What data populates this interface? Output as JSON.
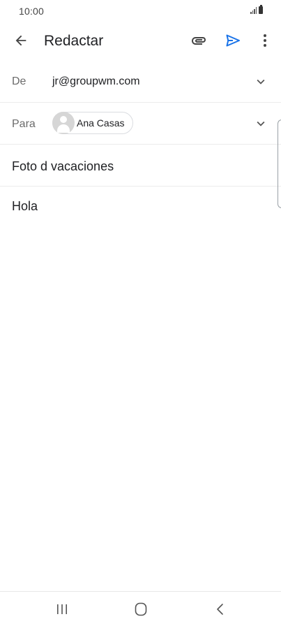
{
  "status_bar": {
    "time": "10:00"
  },
  "app_bar": {
    "title": "Redactar",
    "icons": {
      "back": "arrow-back-icon",
      "attach": "paperclip-icon",
      "send": "send-icon",
      "more": "more-vert-icon"
    },
    "send_color": "#1a73e8"
  },
  "compose": {
    "from": {
      "label": "De",
      "value": "jr@groupwm.com"
    },
    "to": {
      "label": "Para",
      "recipient": "Ana Casas"
    },
    "subject": "Foto d vacaciones",
    "body": "Hola"
  },
  "nav_bar": {
    "icons": [
      "recent-apps-icon",
      "home-icon",
      "back-icon"
    ]
  }
}
